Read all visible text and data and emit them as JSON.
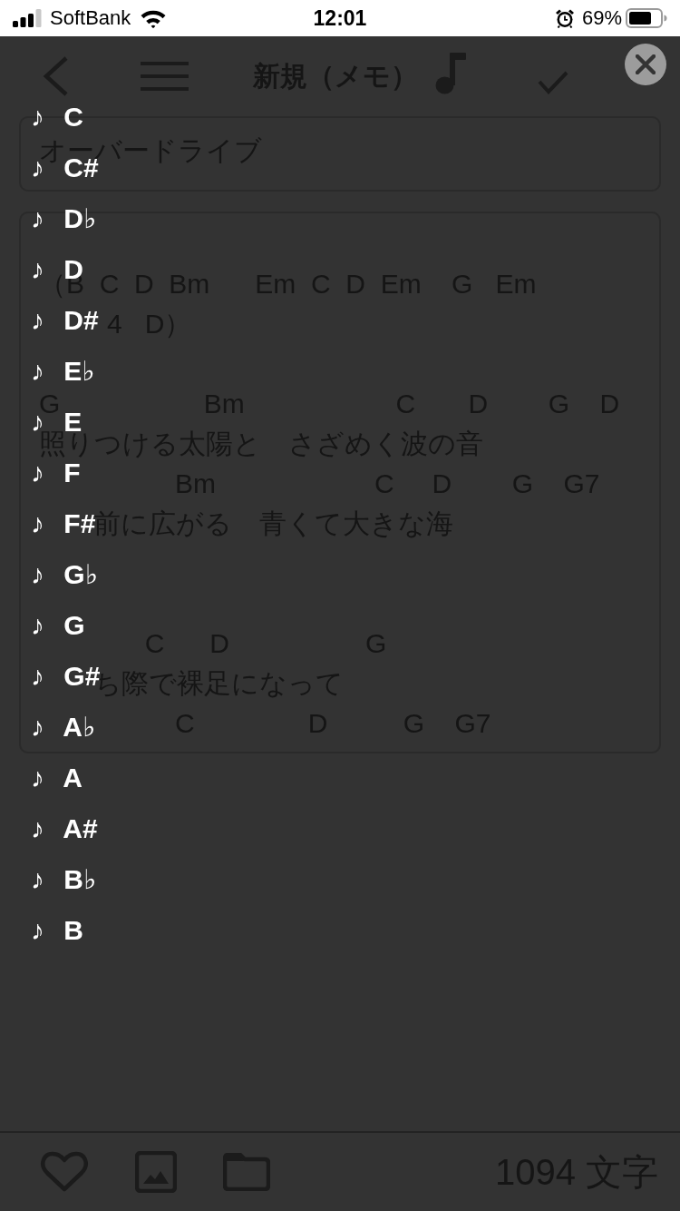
{
  "status_bar": {
    "carrier": "SoftBank",
    "time": "12:01",
    "battery": "69%"
  },
  "nav_bar": {
    "title": "新規（メモ）"
  },
  "title_field": {
    "value": "オーバードライブ"
  },
  "body_field": {
    "value": "（B  C  D  Bm      Em  C  D  Em    G   Em\n         4   D）\n\nG                   Bm                    C       D        G    D\n照りつける太陽と　さざめく波の音\n                  Bm                     C     D        G    G7\n　　前に広がる　青くて大きな海\n\n\n              C      D                  G\n　　ち際で裸足になって\n                  C               D          G    G7"
  },
  "toolbar": {
    "char_count": "1094 文字"
  },
  "key_menu": {
    "items": [
      {
        "label": "♪ C"
      },
      {
        "label": "♪ C#"
      },
      {
        "label": "♪ D♭"
      },
      {
        "label": "♪ D"
      },
      {
        "label": "♪ D#"
      },
      {
        "label": "♪ E♭"
      },
      {
        "label": "♪ E"
      },
      {
        "label": "♪ F"
      },
      {
        "label": "♪ F#"
      },
      {
        "label": "♪ G♭"
      },
      {
        "label": "♪ G"
      },
      {
        "label": "♪ G#"
      },
      {
        "label": "♪ A♭"
      },
      {
        "label": "♪ A"
      },
      {
        "label": "♪ A#"
      },
      {
        "label": "♪ B♭"
      },
      {
        "label": "♪ B"
      }
    ]
  }
}
